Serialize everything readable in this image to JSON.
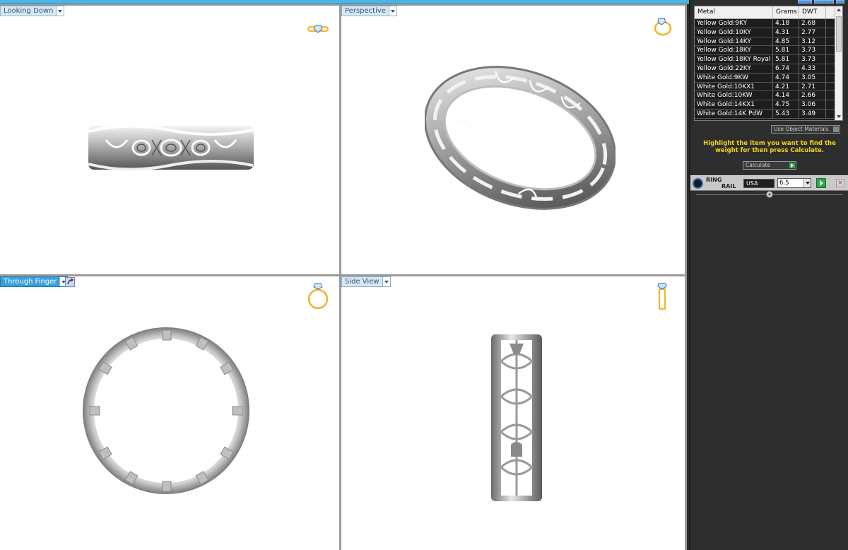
{
  "viewports": {
    "top_left": {
      "label": "Looking Down",
      "active": false
    },
    "top_right": {
      "label": "Perspective",
      "active": false
    },
    "bottom_left": {
      "label": "Through Finger",
      "active": true
    },
    "bottom_right": {
      "label": "Side View",
      "active": false
    }
  },
  "icons": {
    "looking_down_view": "ring-top-icon",
    "perspective_view": "ring-perspective-icon",
    "through_finger_view": "ring-front-icon",
    "side_view": "ring-side-icon",
    "finger_tool": "rotate-tool-icon"
  },
  "metal_table": {
    "headers": {
      "metal": "Metal",
      "grams": "Grams",
      "dwt": "DWT"
    },
    "rows": [
      {
        "metal": "Yellow Gold:9KY",
        "grams": "4.18",
        "dwt": "2.68"
      },
      {
        "metal": "Yellow Gold:10KY",
        "grams": "4.31",
        "dwt": "2.77"
      },
      {
        "metal": "Yellow Gold:14KY",
        "grams": "4.85",
        "dwt": "3.12"
      },
      {
        "metal": "Yellow Gold:18KY",
        "grams": "5.81",
        "dwt": "3.73"
      },
      {
        "metal": "Yellow Gold:18KY Royal",
        "grams": "5.81",
        "dwt": "3.73"
      },
      {
        "metal": "Yellow Gold:22KY",
        "grams": "6.74",
        "dwt": "4.33"
      },
      {
        "metal": "White Gold:9KW",
        "grams": "4.74",
        "dwt": "3.05"
      },
      {
        "metal": "White Gold:10KX1",
        "grams": "4.21",
        "dwt": "2.71"
      },
      {
        "metal": "White Gold:10KW",
        "grams": "4.14",
        "dwt": "2.66"
      },
      {
        "metal": "White Gold:14KX1",
        "grams": "4.75",
        "dwt": "3.06"
      },
      {
        "metal": "White Gold:14K PdW",
        "grams": "5.43",
        "dwt": "3.49"
      }
    ]
  },
  "use_object_materials": "Use Object Materials",
  "hint": "Highlight the item you want to find the weight for then press Calculate.",
  "calculate": "Calculate",
  "ring_rail": {
    "title_line1": "RING",
    "title_line2": "RAIL",
    "country": "USA",
    "size": "6.5",
    "close": "×"
  },
  "colors": {
    "accent": "#3aa0dc",
    "hint_text": "#f2d21a",
    "go_button": "#2fa64a",
    "ring_icon": "#f0b52a"
  }
}
